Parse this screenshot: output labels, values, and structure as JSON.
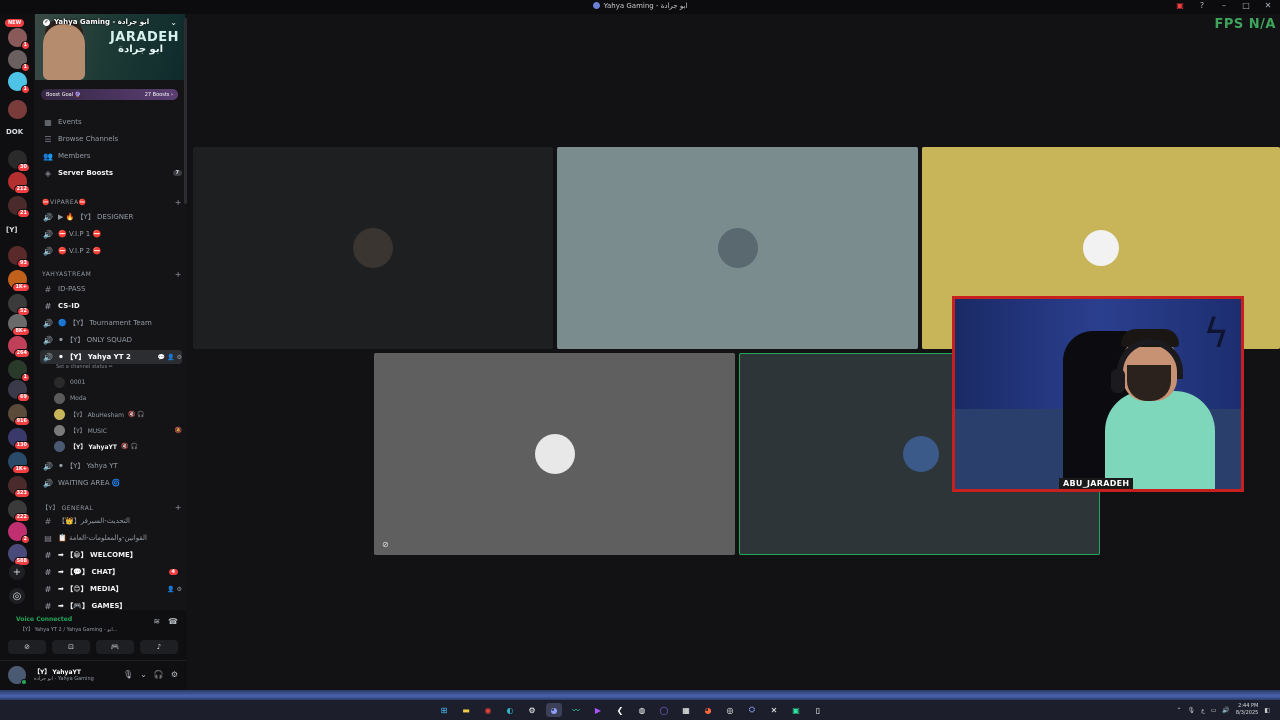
{
  "window": {
    "title": "Yahya Gaming - ابو جرادة",
    "fps_label": "FPS",
    "fps_value": "N/A"
  },
  "server_rail": {
    "new_label": "NEW",
    "items": [
      {
        "badge": "1"
      },
      {
        "badge": "1"
      },
      {
        "badge": "1"
      },
      {
        "text": "DOK"
      },
      {
        "badge": "30"
      },
      {
        "badge": "212"
      },
      {
        "badge": "21"
      },
      {
        "text": "[Y]"
      },
      {
        "badge": "93"
      },
      {
        "badge": "1K+"
      },
      {
        "badge": "52"
      },
      {
        "badge": "8K+"
      },
      {
        "badge": "264"
      },
      {
        "badge": "1"
      },
      {
        "badge": "69"
      },
      {
        "badge": "916"
      },
      {
        "badge": "130"
      },
      {
        "badge": "1K+"
      },
      {
        "badge": "323"
      },
      {
        "badge": "222"
      },
      {
        "badge": "2"
      },
      {
        "badge": "588"
      }
    ],
    "add_icon": "plus-icon",
    "discover_icon": "compass-icon"
  },
  "server": {
    "name": "Yahya Gaming - ابو جرادة",
    "banner_brand": "JARADEH",
    "banner_brand_ar": "ابو جرادة",
    "boost_goal": "Boost Goal 🔮",
    "boost_count": "27 Boosts ›"
  },
  "menu": [
    {
      "label": "Events",
      "icon": "calendar-icon"
    },
    {
      "label": "Browse Channels",
      "icon": "browse-icon"
    },
    {
      "label": "Members",
      "icon": "members-icon"
    },
    {
      "label": "Server Boosts",
      "icon": "boost-icon",
      "badge": "7"
    }
  ],
  "channels": {
    "cat_vip": "⛔VIPAREA⛔",
    "designer": "▶ 🔥 【Y】 DESIGNER",
    "vip1": "⛔ V.I.P 1 ⛔",
    "vip2": "⛔ V.I.P 2 ⛔",
    "cat_stream": "YAHYASTREAM",
    "id_pass": "ID-PASS",
    "cs_id": "CS-ID",
    "tournament": "🔵 【Y】 Tournament Team",
    "only_squad": "⚫ 【Y】 ONLY SQUAD",
    "yahya_yt2": "⚫ 【Y】 Yahya YT 2",
    "status_hint": "Set a channel status ✏",
    "voice_users": [
      {
        "name": "0001",
        "extra": ""
      },
      {
        "name": "Moda",
        "extra": ""
      },
      {
        "name": "【Y】 AbuHesham",
        "extra": "🔇 🎧"
      },
      {
        "name": "【Y】 MUSIC",
        "extra": "🔕"
      },
      {
        "name": "【Y】 YahyaYT",
        "extra": "🔇 🎧"
      }
    ],
    "yahya_yt": "⚫ 【Y】 Yahya YT",
    "waiting": "WAITING AREA 🌀",
    "cat_general": "【Y】 GENERAL",
    "ar1": "【👑】التحديث-السيرفر",
    "ar2": "📋 القوانين-والمعلومات-العامة",
    "welcome": "➡ 【😀】 WELCOME】",
    "chat": "➡ 【💬】 CHAT】",
    "chat_badge": "4",
    "media": "➡ 【😊】 MEDIA】",
    "games": "➡ 【🎮】 GAMES】"
  },
  "voice": {
    "status": "Voice Connected",
    "location": "【Y】 Yahya YT 2 / Yahya Gaming - ابو..."
  },
  "user": {
    "name": "【Y】 YahyaYT",
    "subtitle": "ابو جرادة - Yahya Gaming"
  },
  "stage": {
    "tiles": [
      {
        "name": "tile-1",
        "bg": "#1e1f20"
      },
      {
        "name": "tile-2",
        "bg": "#7b8c8f"
      },
      {
        "name": "tile-3",
        "bg": "#c8b55a"
      },
      {
        "name": "tile-4",
        "bg": "#5e5f5e"
      },
      {
        "name": "tile-5",
        "bg": "#2d3539"
      }
    ],
    "camera_label": "ABU_JARADEH"
  },
  "taskbar": {
    "time": "2:44 PM",
    "date": "8/3/2025"
  },
  "colors": {
    "accent_green": "#3fa45b",
    "speaking_border": "#23a55a",
    "camera_border": "#c8201f"
  }
}
